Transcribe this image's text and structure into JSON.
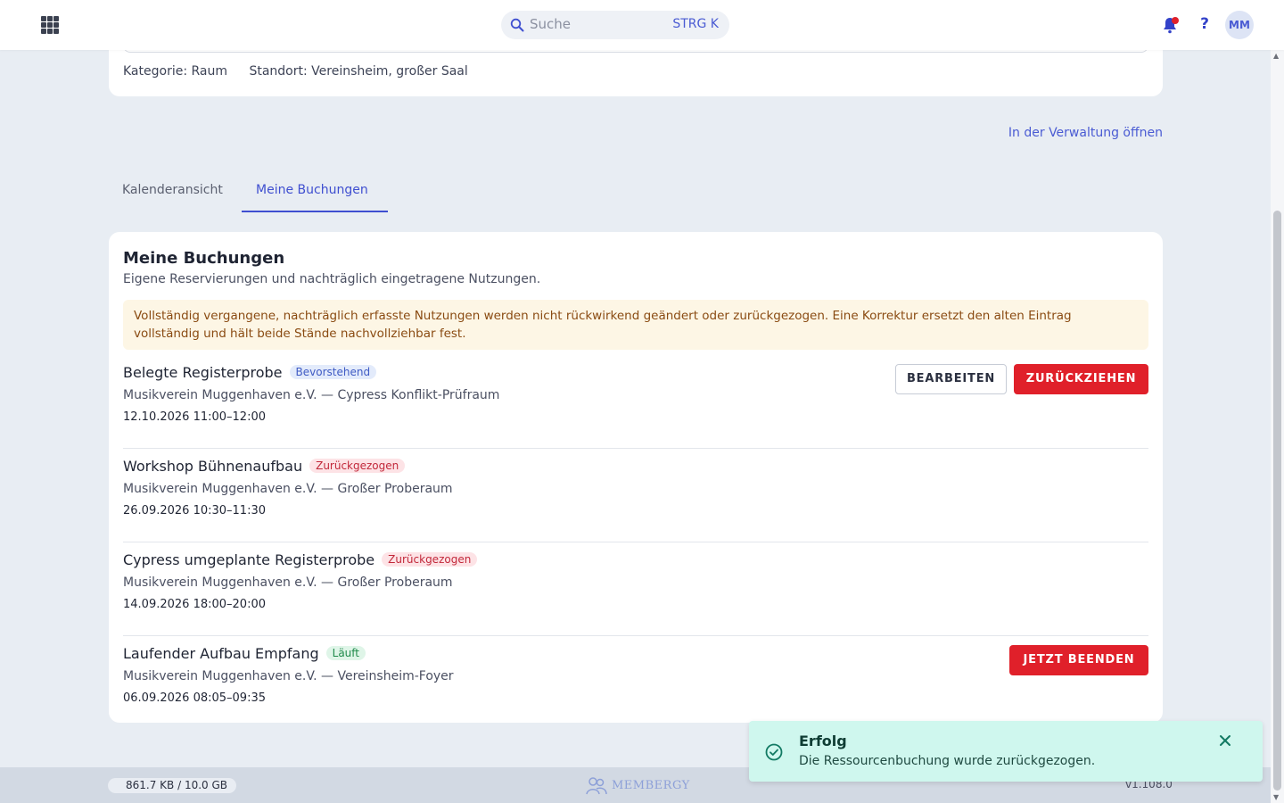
{
  "header": {
    "search_placeholder": "Suche",
    "search_shortcut": "STRG K",
    "help_label": "?",
    "avatar_initials": "MM",
    "notification_dot": true
  },
  "resource": {
    "category": "Kategorie: Raum",
    "location": "Standort: Vereinsheim, großer Saal",
    "admin_link": "In der Verwaltung öffnen"
  },
  "tabs": [
    {
      "label": "Kalenderansicht",
      "active": false
    },
    {
      "label": "Meine Buchungen",
      "active": true
    }
  ],
  "bookings_card": {
    "title": "Meine Buchungen",
    "subtitle": "Eigene Reservierungen und nachträglich eingetragene Nutzungen.",
    "notice": "Vollständig vergangene, nachträglich erfasste Nutzungen werden nicht rückwirkend geändert oder zurückgezogen. Eine Korrektur ersetzt den alten Eintrag vollständig und hält beide Stände nachvollziehbar fest."
  },
  "bookings": [
    {
      "title": "Belegte Registerprobe",
      "status": "Bevorstehend",
      "org": "Musikverein Muggenhaven e.V. — Cypress Konflikt-Prüfraum",
      "time": "12.10.2026 11:00–12:00",
      "edit_label": "BEARBEITEN",
      "withdraw_label": "ZURÜCKZIEHEN"
    },
    {
      "title": "Workshop Bühnenaufbau",
      "status": "Zurückgezogen",
      "org": "Musikverein Muggenhaven e.V. — Großer Proberaum",
      "time": "26.09.2026 10:30–11:30"
    },
    {
      "title": "Cypress umgeplante Registerprobe",
      "status": "Zurückgezogen",
      "org": "Musikverein Muggenhaven e.V. — Großer Proberaum",
      "time": "14.09.2026 18:00–20:00"
    },
    {
      "title": "Laufender Aufbau Empfang",
      "status": "Läuft",
      "org": "Musikverein Muggenhaven e.V. — Vereinsheim-Foyer",
      "time": "06.09.2026 08:05–09:35",
      "end_label": "JETZT BEENDEN"
    }
  ],
  "footer": {
    "storage": "861.7 KB / 10.0 GB",
    "logo": "MEMBERGY",
    "version": "v1.108.0"
  },
  "toast": {
    "title": "Erfolg",
    "message": "Die Ressourcenbuchung wurde zurückgezogen."
  },
  "colors": {
    "accent": "#3f4fd0",
    "danger": "#e0202a",
    "toast_bg": "#cff7ee",
    "page_bg": "#e8edf3"
  }
}
